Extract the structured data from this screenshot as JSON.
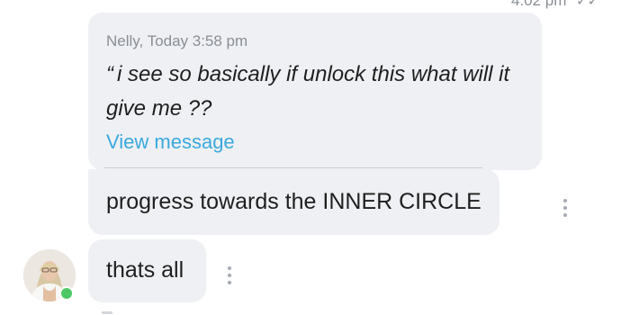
{
  "top_status": {
    "time_partial": "4:02 pm"
  },
  "reply_bubble": {
    "author_time": "Nelly, Today 3:58 pm",
    "open_quote": "“",
    "quoted_text": "i see so basically if unlock this what will it give me ??",
    "view_link": "View message"
  },
  "reply_message": {
    "text": "progress towards the INNER CIRCLE"
  },
  "small_message": {
    "text": "thats all"
  },
  "avatar": {
    "status": "online"
  },
  "colors": {
    "bubble_bg": "#eef0f3",
    "link": "#3aa9dd",
    "meta_text": "#8a8f96",
    "online": "#4cc764"
  },
  "icons": [
    "double-check-icon",
    "more-vertical-icon"
  ]
}
